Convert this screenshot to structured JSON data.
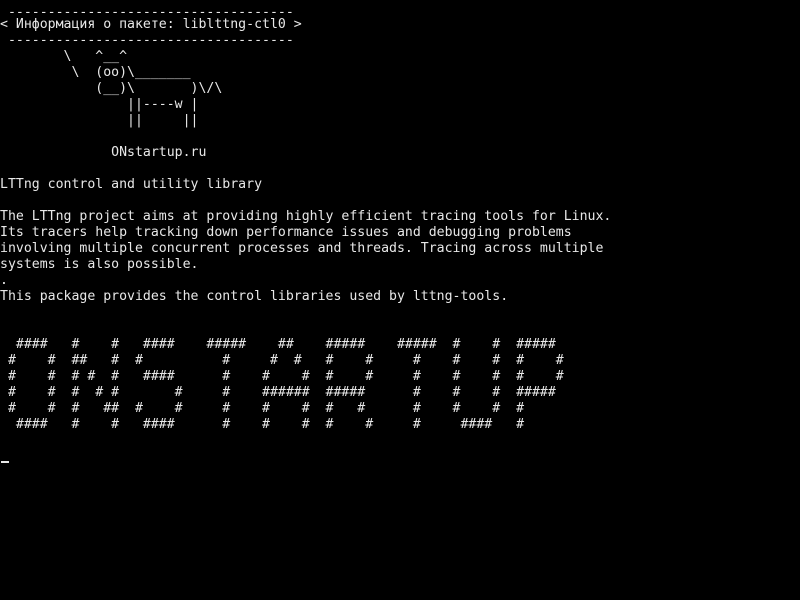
{
  "screen": {
    "speech_bubble": {
      "top_border": " ------------------------------------",
      "text": "< Информация о пакете: liblttng-ctl0 >",
      "bottom_border": " ------------------------------------"
    },
    "cow": [
      "        \\   ^__^",
      "         \\  (oo)\\_______",
      "            (__)\\       )\\/\\",
      "                ||----w |",
      "                ||     ||"
    ],
    "site": "              ONstartup.ru",
    "summary": "LTTng control and utility library",
    "description": [
      "The LTTng project aims at providing highly efficient tracing tools for Linux.",
      "Its tracers help tracking down performance issues and debugging problems",
      "involving multiple concurrent processes and threads. Tracing across multiple",
      "systems is also possible.",
      ".",
      "This package provides the control libraries used by lttng-tools."
    ],
    "banner": [
      "  ####   #    #   ####    #####    ##    #####    #####  #    #  #####",
      " #    #  ##   #  #          #     #  #   #    #     #    #    #  #    #",
      " #    #  # #  #   ####      #    #    #  #    #     #    #    #  #    #",
      " #    #  #  # #       #     #    ######  #####      #    #    #  #####",
      " #    #  #   ##  #    #     #    #    #  #   #      #    #    #  #",
      "  ####   #    #   ####      #    #    #  #    #     #     ####   #"
    ]
  },
  "colors": {
    "background": "#000000",
    "foreground": "#e8e8e8"
  }
}
